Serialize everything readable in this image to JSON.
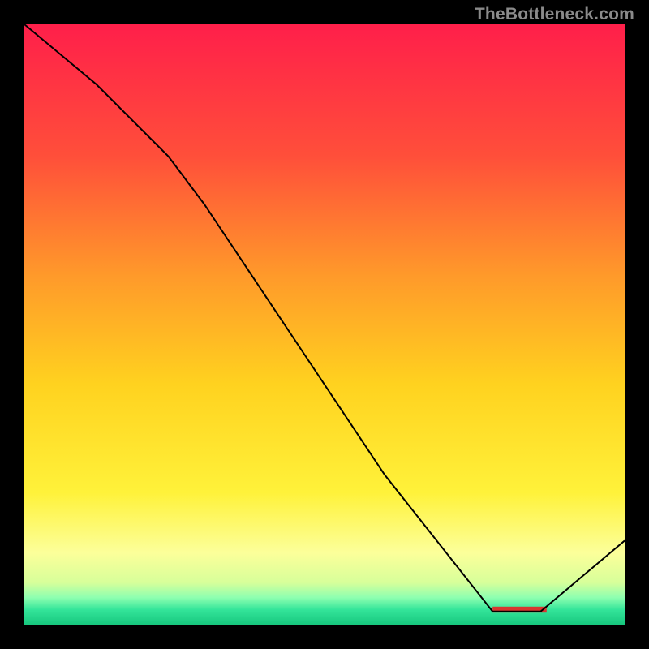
{
  "watermark": "TheBottleneck.com",
  "chart_data": {
    "type": "line",
    "title": "",
    "xlabel": "",
    "ylabel": "",
    "xlim": [
      0,
      100
    ],
    "ylim": [
      0,
      100
    ],
    "grid": false,
    "background_gradient": {
      "stops": [
        {
          "offset": 0.0,
          "color": "#ff1f4a"
        },
        {
          "offset": 0.22,
          "color": "#ff4f3a"
        },
        {
          "offset": 0.42,
          "color": "#ff9a2a"
        },
        {
          "offset": 0.6,
          "color": "#ffd21f"
        },
        {
          "offset": 0.78,
          "color": "#fff23a"
        },
        {
          "offset": 0.88,
          "color": "#fcff9a"
        },
        {
          "offset": 0.93,
          "color": "#d7ff9a"
        },
        {
          "offset": 0.955,
          "color": "#8dffb0"
        },
        {
          "offset": 0.975,
          "color": "#34e59a"
        },
        {
          "offset": 1.0,
          "color": "#17c77e"
        }
      ]
    },
    "series": [
      {
        "name": "bottleneck-curve",
        "color": "#000000",
        "width": 2,
        "points": [
          {
            "x": 0.0,
            "y": 100.0
          },
          {
            "x": 12.0,
            "y": 90.0
          },
          {
            "x": 24.0,
            "y": 78.0
          },
          {
            "x": 30.0,
            "y": 70.0
          },
          {
            "x": 60.0,
            "y": 25.0
          },
          {
            "x": 78.0,
            "y": 2.2
          },
          {
            "x": 80.0,
            "y": 2.2
          },
          {
            "x": 86.0,
            "y": 2.2
          },
          {
            "x": 100.0,
            "y": 14.0
          }
        ]
      }
    ],
    "annotations": [
      {
        "id": "optimal-band",
        "shape": "rect",
        "x0": 78.0,
        "x1": 87.0,
        "y0": 2.0,
        "y1": 3.0,
        "fill": "#d8362f",
        "note": "red bar marking the optimal region near the curve minimum"
      }
    ]
  }
}
